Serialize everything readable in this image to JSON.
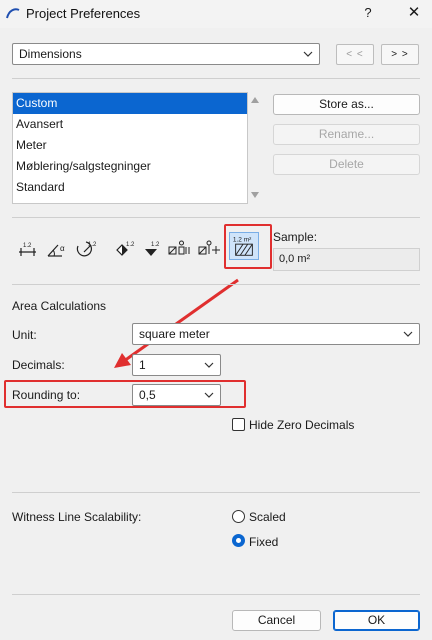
{
  "window": {
    "title": "Project Preferences",
    "help": "?",
    "close": "✕"
  },
  "preference_dropdown": {
    "value": "Dimensions",
    "prev_label": "< <",
    "next_label": "> >"
  },
  "schemes": {
    "items": [
      "Custom",
      "Avansert",
      "Meter",
      "Møblering/salgstegninger",
      "Standard"
    ],
    "selected": "Custom"
  },
  "scheme_buttons": {
    "store": "Store as...",
    "rename": "Rename...",
    "delete": "Delete"
  },
  "dimension_types": {
    "icons": [
      "linear-dimension-icon",
      "angle-dimension-icon",
      "radial-dimension-icon",
      "level-dimension-icon",
      "elevation-dimension-icon",
      "door-window-dimension-icon",
      "sill-height-dimension-icon",
      "area-calculation-icon"
    ],
    "badges": [
      "1.2",
      "α",
      "1.2",
      "1.2",
      "1.2",
      "1.2 m²"
    ],
    "selected": "area-calculation-icon"
  },
  "sample": {
    "label": "Sample:",
    "value": "0,0 m²"
  },
  "area": {
    "title": "Area Calculations",
    "unit_label": "Unit:",
    "unit_value": "square meter",
    "decimals_label": "Decimals:",
    "decimals_value": "1",
    "rounding_label": "Rounding to:",
    "rounding_value": "0,5",
    "hide_zero_label": "Hide Zero Decimals",
    "hide_zero_checked": false
  },
  "witness": {
    "label": "Witness Line Scalability:",
    "scaled": "Scaled",
    "fixed": "Fixed",
    "selected": "Fixed"
  },
  "footer": {
    "cancel": "Cancel",
    "ok": "OK"
  },
  "colors": {
    "accent": "#0b66d0",
    "annotation": "#e02f2f"
  }
}
